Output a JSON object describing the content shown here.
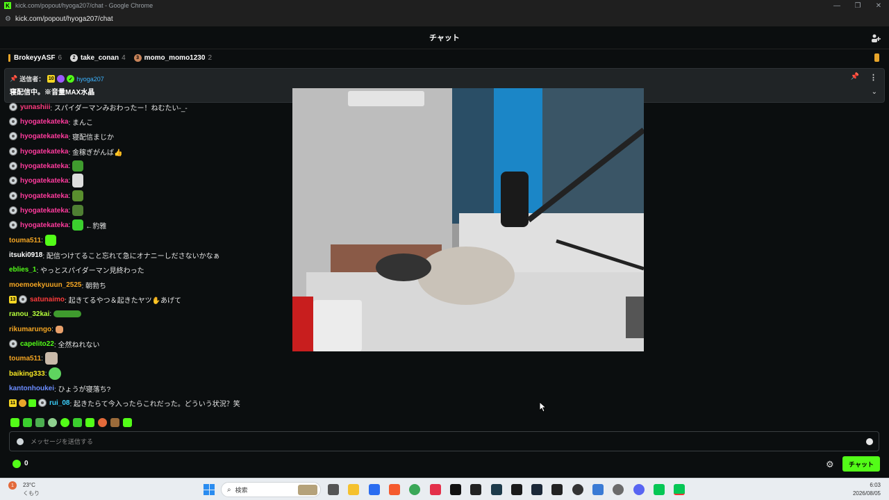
{
  "window": {
    "title": "kick.com/popout/hyoga207/chat - Google Chrome",
    "url": "kick.com/popout/hyoga207/chat"
  },
  "chat": {
    "header": "チャット"
  },
  "gifters": [
    {
      "name": "BrokeyyASF",
      "count": "6"
    },
    {
      "rank": "2",
      "name": "take_conan",
      "count": "4"
    },
    {
      "rank": "3",
      "name": "momo_momo1230",
      "count": "2"
    }
  ],
  "pinned": {
    "label": "送信者：",
    "sub_months": "10",
    "user": "hyoga207",
    "text": "寝配信中。※音量MAX水晶"
  },
  "messages": [
    {
      "user": "yunashiii",
      "text": ": スパイダーマンみおわったー！ねむたい-_-",
      "color": "#ff3b7f"
    },
    {
      "user": "hyogatekateka",
      "text": ": まんこ",
      "color": "#ff3b9d"
    },
    {
      "user": "hyogatekateka",
      "text": ": 寝配信まじか",
      "color": "#ff3b9d"
    },
    {
      "user": "hyogatekateka",
      "text": ": 金稼ぎがんば👍",
      "color": "#ff3b9d"
    },
    {
      "user": "hyogatekateka",
      "text": ":",
      "color": "#ff3b9d"
    },
    {
      "user": "hyogatekateka",
      "text": ":",
      "color": "#ff3b9d"
    },
    {
      "user": "hyogatekateka",
      "text": ":",
      "color": "#ff3b9d"
    },
    {
      "user": "hyogatekateka",
      "text": ":",
      "color": "#ff3b9d"
    },
    {
      "user": "hyogatekateka",
      "text": ":",
      "text2": "←豹雅",
      "color": "#ff3b9d"
    },
    {
      "user": "touma511",
      "text": ":",
      "color": "#f5a623"
    },
    {
      "user": "itsuki0918",
      "text": ": 配信つけてること忘れて急にオナニーしださないかなぁ",
      "color": "#ffffff"
    },
    {
      "user": "eblies_1",
      "text": ": やっとスパイダーマン見終わった",
      "color": "#53fc18"
    },
    {
      "user": "moemoekyuuun_2525",
      "text": ": 朝勃ち",
      "color": "#f5a623"
    },
    {
      "user": "satunaimo",
      "text": ": 起きてるやつ＆起きたヤツ✋あげて",
      "color": "#ff3b3b",
      "sub": "13"
    },
    {
      "user": "ranou_32kai",
      "text": ":",
      "color": "#b6ff3b"
    },
    {
      "user": "rikumarungo",
      "text": ":",
      "color": "#f5a623"
    },
    {
      "user": "capelito22",
      "text": ": 全然ねれない",
      "color": "#53fc18"
    },
    {
      "user": "touma511",
      "text": ":",
      "color": "#f5a623"
    },
    {
      "user": "baiking333",
      "text": ":",
      "color": "#f5e623"
    },
    {
      "user": "kantonhoukei",
      "text": ": ひょうが寝落ち?",
      "color": "#6b8cff"
    },
    {
      "user": "rui_08",
      "text": ": 起きたらて今入ったらこれだった。どういう状況？笑",
      "color": "#3bd1ff",
      "sub": "11"
    }
  ],
  "input": {
    "placeholder": "メッセージを送信する"
  },
  "bottom": {
    "count": "0",
    "send": "チャット"
  },
  "taskbar": {
    "weather_temp": "23°C",
    "weather_desc": "くもり",
    "weather_badge": "1",
    "search": "検索",
    "time": "6:03",
    "date": "2026/08/05"
  },
  "colors": {
    "accent": "#53fc18",
    "bg": "#0b0e0f"
  }
}
